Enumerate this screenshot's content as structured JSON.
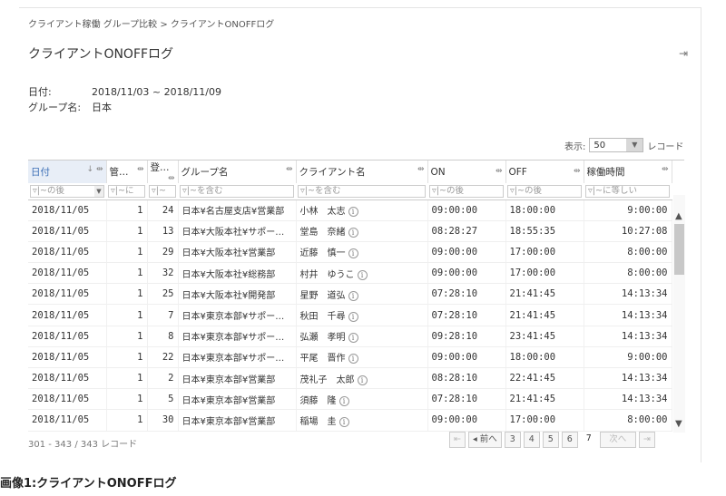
{
  "breadcrumb": "クライアント稼働 グループ比較 > クライアントONOFFログ",
  "title": "クライアントONOFFログ",
  "meta": {
    "date_label": "日付:",
    "date_value": "2018/11/03 ~ 2018/11/09",
    "group_label": "グループ名:",
    "group_value": "日本"
  },
  "display": {
    "label": "表示:",
    "value": "50",
    "unit": "レコード"
  },
  "columns": [
    {
      "label": "日付",
      "filter": "~の後"
    },
    {
      "label": "管…",
      "filter": "~に"
    },
    {
      "label": "登…",
      "filter": "~"
    },
    {
      "label": "グループ名",
      "filter": "~を含む"
    },
    {
      "label": "クライアント名",
      "filter": "~を含む"
    },
    {
      "label": "ON",
      "filter": "~の後"
    },
    {
      "label": "OFF",
      "filter": "~の後"
    },
    {
      "label": "稼働時間",
      "filter": "~に等しい"
    }
  ],
  "rows": [
    [
      "2018/11/05",
      "1",
      "24",
      "日本¥名古屋支店¥営業部",
      "小林　太志",
      "09:00:00",
      "18:00:00",
      "9:00:00"
    ],
    [
      "2018/11/05",
      "1",
      "13",
      "日本¥大阪本社¥サポー…",
      "堂島　奈緒",
      "08:28:27",
      "18:55:35",
      "10:27:08"
    ],
    [
      "2018/11/05",
      "1",
      "29",
      "日本¥大阪本社¥営業部",
      "近藤　慎一",
      "09:00:00",
      "17:00:00",
      "8:00:00"
    ],
    [
      "2018/11/05",
      "1",
      "32",
      "日本¥大阪本社¥総務部",
      "村井　ゆうこ",
      "09:00:00",
      "17:00:00",
      "8:00:00"
    ],
    [
      "2018/11/05",
      "1",
      "25",
      "日本¥大阪本社¥開発部",
      "星野　道弘",
      "07:28:10",
      "21:41:45",
      "14:13:34"
    ],
    [
      "2018/11/05",
      "1",
      "7",
      "日本¥東京本部¥サポー…",
      "秋田　千尋",
      "07:28:10",
      "21:41:45",
      "14:13:34"
    ],
    [
      "2018/11/05",
      "1",
      "8",
      "日本¥東京本部¥サポー…",
      "弘瀬　孝明",
      "09:28:10",
      "23:41:45",
      "14:13:34"
    ],
    [
      "2018/11/05",
      "1",
      "22",
      "日本¥東京本部¥サポー…",
      "平尾　晋作",
      "09:00:00",
      "18:00:00",
      "9:00:00"
    ],
    [
      "2018/11/05",
      "1",
      "2",
      "日本¥東京本部¥営業部",
      "茂礼子　太郎",
      "08:28:10",
      "22:41:45",
      "14:13:34"
    ],
    [
      "2018/11/05",
      "1",
      "5",
      "日本¥東京本部¥営業部",
      "須藤　隆",
      "07:28:10",
      "21:41:45",
      "14:13:34"
    ],
    [
      "2018/11/05",
      "1",
      "30",
      "日本¥東京本部¥営業部",
      "稲場　圭",
      "09:00:00",
      "17:00:00",
      "8:00:00"
    ]
  ],
  "footer": {
    "count": "301 - 343 / 343 レコード"
  },
  "pager": {
    "first": "⇤",
    "prev": "◂ 前へ",
    "pages": [
      "3",
      "4",
      "5",
      "6"
    ],
    "current": "7",
    "next": "次へ",
    "last": "⇥"
  },
  "caption": "画像1:クライアントONOFFログ"
}
